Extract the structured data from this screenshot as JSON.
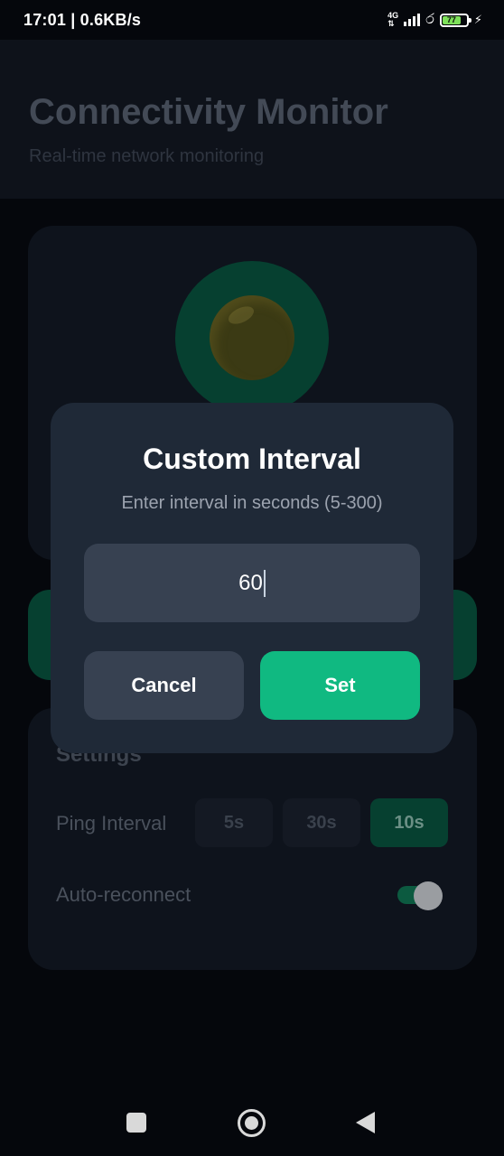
{
  "status_bar": {
    "time_speed": "17:01 | 0.6KB/s",
    "network": "4G",
    "battery": "77"
  },
  "app": {
    "title": "Connectivity Monitor",
    "subtitle": "Real-time network monitoring"
  },
  "settings": {
    "title": "Settings",
    "ping_interval_label": "Ping Interval",
    "interval_options": [
      "5s",
      "30s",
      "10s"
    ],
    "auto_reconnect_label": "Auto-reconnect",
    "auto_reconnect_enabled": true
  },
  "dialog": {
    "title": "Custom Interval",
    "subtitle": "Enter interval in seconds (5-300)",
    "input_value": "60",
    "cancel_label": "Cancel",
    "set_label": "Set"
  },
  "colors": {
    "accent": "#10b981",
    "dialog_bg": "#1f2937",
    "input_bg": "#374151"
  }
}
